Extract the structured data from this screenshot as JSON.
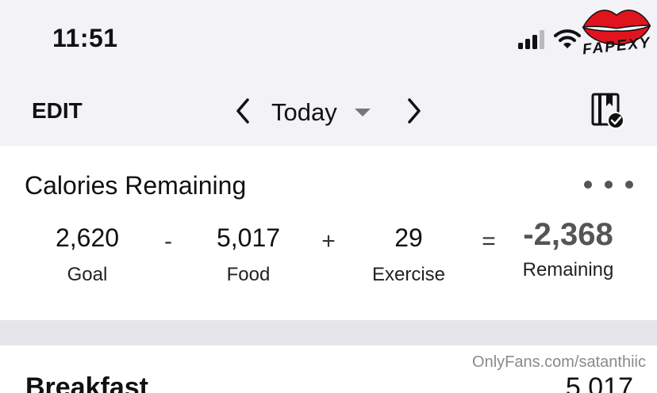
{
  "status_bar": {
    "time": "11:51",
    "icons": [
      "cellular-signal-icon",
      "wifi-icon"
    ]
  },
  "watermark": {
    "logo_text": "FAPEXY",
    "logo_color": "#e0141e",
    "url": "OnlyFans.com/satanthiic"
  },
  "nav": {
    "edit_label": "EDIT",
    "date_label": "Today",
    "icons": [
      "chevron-left-icon",
      "caret-down-icon",
      "chevron-right-icon",
      "diary-complete-icon"
    ]
  },
  "calories": {
    "title": "Calories Remaining",
    "goal": {
      "value": "2,620",
      "label": "Goal"
    },
    "minus": "-",
    "food": {
      "value": "5,017",
      "label": "Food"
    },
    "plus": "+",
    "exercise": {
      "value": "29",
      "label": "Exercise"
    },
    "equals": "=",
    "remaining": {
      "value": "-2,368",
      "label": "Remaining"
    }
  },
  "meal": {
    "title": "Breakfast",
    "total": "5,017"
  },
  "colors": {
    "background": "#f2f2f7",
    "card": "#ffffff",
    "remaining_value": "#555555"
  }
}
